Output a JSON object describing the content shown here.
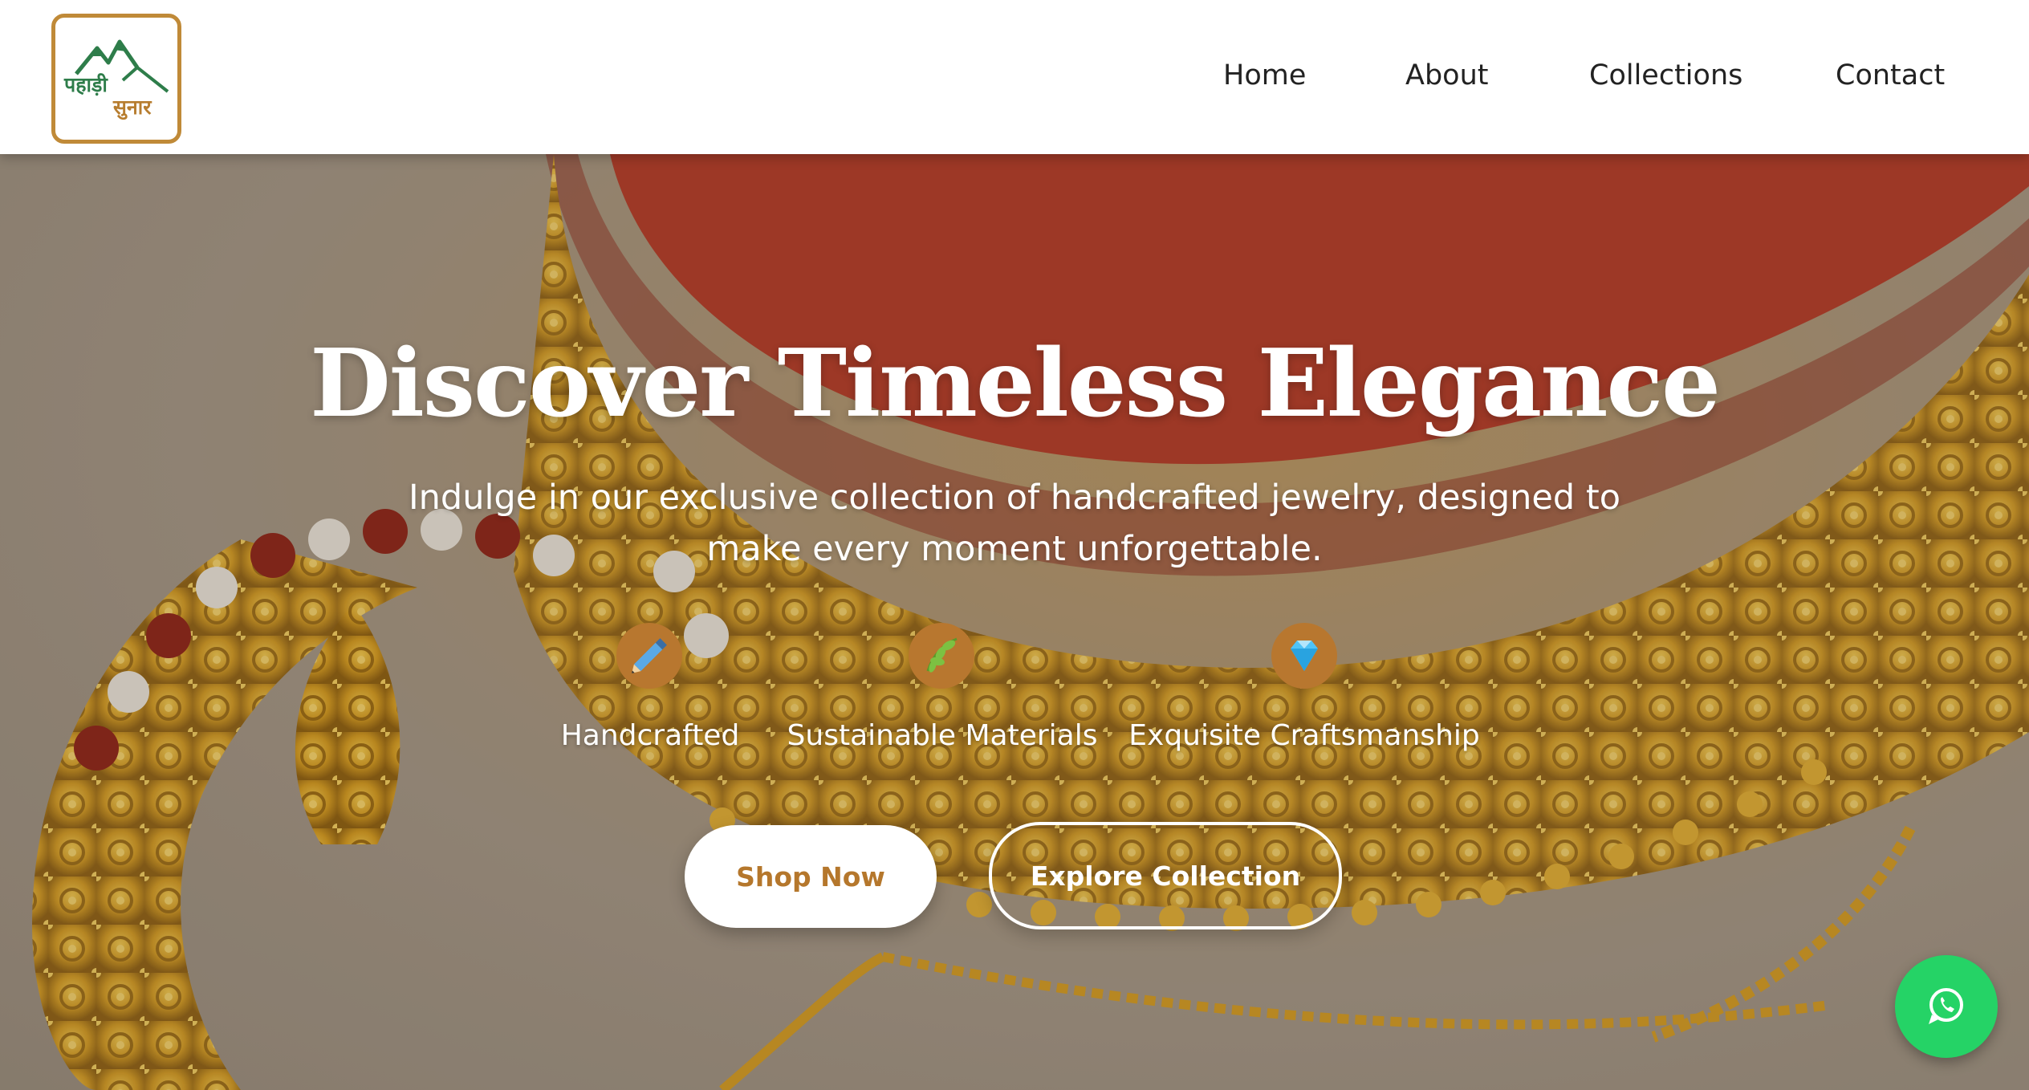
{
  "brand": {
    "logo_line1": "पहाड़ी",
    "logo_line2": "सुनार",
    "logo_icon": "mountain-icon",
    "colors": {
      "green": "#2e7d4a",
      "gold": "#c08a38"
    }
  },
  "nav": {
    "items": [
      {
        "label": "Home"
      },
      {
        "label": "About"
      },
      {
        "label": "Collections"
      },
      {
        "label": "Contact"
      }
    ]
  },
  "hero": {
    "title": "Discover Timeless Elegance",
    "subtitle_line1": "Indulge in our exclusive collection of handcrafted jewelry, designed to",
    "subtitle_line2": "make every moment unforgettable.",
    "features": [
      {
        "label": "Handcrafted",
        "icon": "pencil-icon"
      },
      {
        "label": "Sustainable Materials",
        "icon": "leaf-icon"
      },
      {
        "label": "Exquisite Craftsmanship",
        "icon": "diamond-icon"
      }
    ],
    "buttons": {
      "primary": "Shop Now",
      "secondary": "Explore Collection"
    },
    "accent_color": "#b8772f"
  },
  "floating": {
    "whatsapp_icon": "whatsapp-icon",
    "color": "#25d366"
  }
}
